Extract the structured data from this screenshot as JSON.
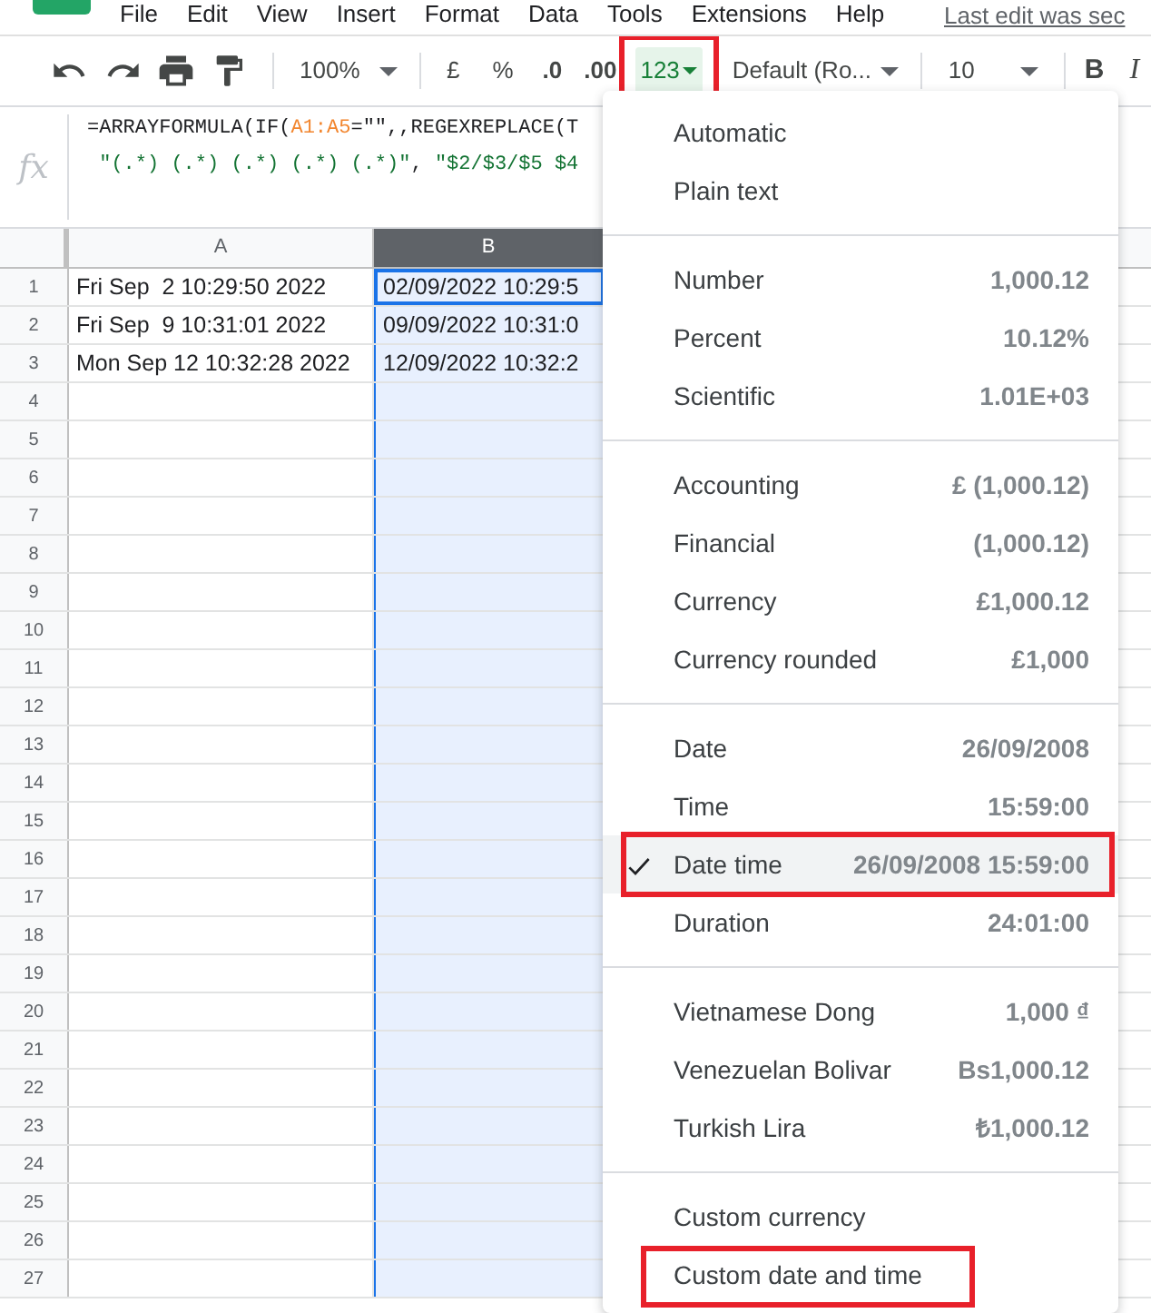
{
  "menu_bar": {
    "items": [
      "File",
      "Edit",
      "View",
      "Insert",
      "Format",
      "Data",
      "Tools",
      "Extensions",
      "Help"
    ],
    "last_edit": "Last edit was sec"
  },
  "toolbar": {
    "zoom": "100%",
    "currency": "£",
    "percent": "%",
    "decrease_decimals": ".0",
    "increase_decimals": ".00",
    "format_button": {
      "label": "123",
      "expanded": true,
      "highlighted": true
    },
    "font": "Default (Ro...",
    "font_size": "10",
    "bold": "B",
    "italic": "I"
  },
  "formula_bar": {
    "fx": "fx",
    "lines": [
      [
        {
          "kind": "plain",
          "text": "=ARRAYFORMULA(IF("
        },
        {
          "kind": "range",
          "text": "A1:A5"
        },
        {
          "kind": "plain",
          "text": "=\"\",,REGEXREPLACE(T"
        }
      ],
      [
        {
          "kind": "string",
          "text": " \"(.*) (.*) (.*) (.*) (.*)\""
        },
        {
          "kind": "plain",
          "text": ", "
        },
        {
          "kind": "string",
          "text": "\"$2/$3/$5 $4"
        }
      ]
    ]
  },
  "sheet": {
    "columns": [
      {
        "label": "A",
        "selected": false
      },
      {
        "label": "B",
        "selected": true
      }
    ],
    "rows": [
      {
        "number": "1",
        "cells": [
          "Fri Sep  2 10:29:50 2022",
          "02/09/2022 10:29:5"
        ]
      },
      {
        "number": "2",
        "cells": [
          "Fri Sep  9 10:31:01 2022",
          "09/09/2022 10:31:0"
        ]
      },
      {
        "number": "3",
        "cells": [
          "Mon Sep 12 10:32:28 2022",
          "12/09/2022 10:32:2"
        ]
      },
      {
        "number": "4",
        "cells": []
      },
      {
        "number": "5",
        "cells": []
      },
      {
        "number": "6",
        "cells": []
      },
      {
        "number": "7",
        "cells": []
      },
      {
        "number": "8",
        "cells": []
      },
      {
        "number": "9",
        "cells": []
      },
      {
        "number": "10",
        "cells": []
      },
      {
        "number": "11",
        "cells": []
      },
      {
        "number": "12",
        "cells": []
      },
      {
        "number": "13",
        "cells": []
      },
      {
        "number": "14",
        "cells": []
      },
      {
        "number": "15",
        "cells": []
      },
      {
        "number": "16",
        "cells": []
      },
      {
        "number": "17",
        "cells": []
      },
      {
        "number": "18",
        "cells": []
      },
      {
        "number": "19",
        "cells": []
      },
      {
        "number": "20",
        "cells": []
      },
      {
        "number": "21",
        "cells": []
      },
      {
        "number": "22",
        "cells": []
      },
      {
        "number": "23",
        "cells": []
      },
      {
        "number": "24",
        "cells": []
      },
      {
        "number": "25",
        "cells": []
      },
      {
        "number": "26",
        "cells": []
      },
      {
        "number": "27",
        "cells": []
      }
    ]
  },
  "format_menu": {
    "sections": [
      [
        {
          "label": "Automatic",
          "checked": false,
          "highlighted": false
        },
        {
          "label": "Plain text",
          "checked": false,
          "highlighted": false
        }
      ],
      [
        {
          "label": "Number",
          "example": "1,000.12",
          "checked": false,
          "highlighted": false
        },
        {
          "label": "Percent",
          "example": "10.12%",
          "checked": false,
          "highlighted": false
        },
        {
          "label": "Scientific",
          "example": "1.01E+03",
          "checked": false,
          "highlighted": false
        }
      ],
      [
        {
          "label": "Accounting",
          "example": "£ (1,000.12)",
          "checked": false,
          "highlighted": false
        },
        {
          "label": "Financial",
          "example": "(1,000.12)",
          "checked": false,
          "highlighted": false
        },
        {
          "label": "Currency",
          "example": "£1,000.12",
          "checked": false,
          "highlighted": false
        },
        {
          "label": "Currency rounded",
          "example": "£1,000",
          "checked": false,
          "highlighted": false
        }
      ],
      [
        {
          "label": "Date",
          "example": "26/09/2008",
          "checked": false,
          "highlighted": false
        },
        {
          "label": "Time",
          "example": "15:59:00",
          "checked": false,
          "highlighted": false
        },
        {
          "label": "Date time",
          "example": "26/09/2008 15:59:00",
          "checked": true,
          "highlighted": true
        },
        {
          "label": "Duration",
          "example": "24:01:00",
          "checked": false,
          "highlighted": false
        }
      ],
      [
        {
          "label": "Vietnamese Dong",
          "example": "1,000 ₫",
          "checked": false,
          "highlighted": false
        },
        {
          "label": "Venezuelan Bolivar",
          "example": "Bs1,000.12",
          "checked": false,
          "highlighted": false
        },
        {
          "label": "Turkish Lira",
          "example": "₺1,000.12",
          "checked": false,
          "highlighted": false
        }
      ],
      [
        {
          "label": "Custom currency",
          "checked": false,
          "highlighted": false
        },
        {
          "label": "Custom date and time",
          "checked": false,
          "highlighted": true
        }
      ]
    ]
  }
}
